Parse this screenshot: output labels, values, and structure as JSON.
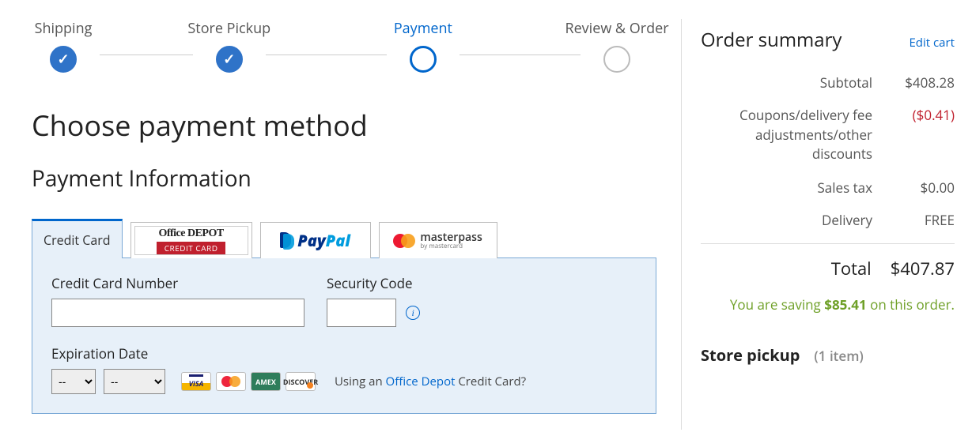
{
  "stepper": {
    "steps": [
      {
        "label": "Shipping",
        "state": "done"
      },
      {
        "label": "Store Pickup",
        "state": "done"
      },
      {
        "label": "Payment",
        "state": "active"
      },
      {
        "label": "Review & Order",
        "state": "future"
      }
    ]
  },
  "page_title": "Choose payment method",
  "section_title": "Payment Information",
  "tabs": {
    "credit_card": "Credit Card",
    "office_depot_line1": "Office DEPOT",
    "office_depot_line2": "CREDIT CARD",
    "paypal_pay": "Pay",
    "paypal_pal": "Pal",
    "masterpass": "masterpass",
    "masterpass_sub": "by mastercard"
  },
  "form": {
    "cc_number_label": "Credit Card Number",
    "cc_number_value": "",
    "security_code_label": "Security Code",
    "security_code_value": "",
    "expiration_label": "Expiration Date",
    "month_value": "--",
    "year_value": "--",
    "using_prefix": "Using an ",
    "using_link": "Office Depot",
    "using_suffix": " Credit Card?",
    "card_logos": {
      "visa": "VISA",
      "amex": "AMEX",
      "discover": "DISCOVER"
    }
  },
  "summary": {
    "title": "Order summary",
    "edit_cart": "Edit cart",
    "rows": {
      "subtotal_label": "Subtotal",
      "subtotal_value": "$408.28",
      "discount_label": "Coupons/delivery fee adjustments/other discounts",
      "discount_value": "($0.41)",
      "tax_label": "Sales tax",
      "tax_value": "$0.00",
      "delivery_label": "Delivery",
      "delivery_value": "FREE",
      "total_label": "Total",
      "total_value": "$407.87"
    },
    "savings_prefix": "You are saving ",
    "savings_amount": "$85.41",
    "savings_suffix": " on this order.",
    "store_pickup_label": "Store pickup",
    "store_pickup_count": "(1 item)"
  }
}
